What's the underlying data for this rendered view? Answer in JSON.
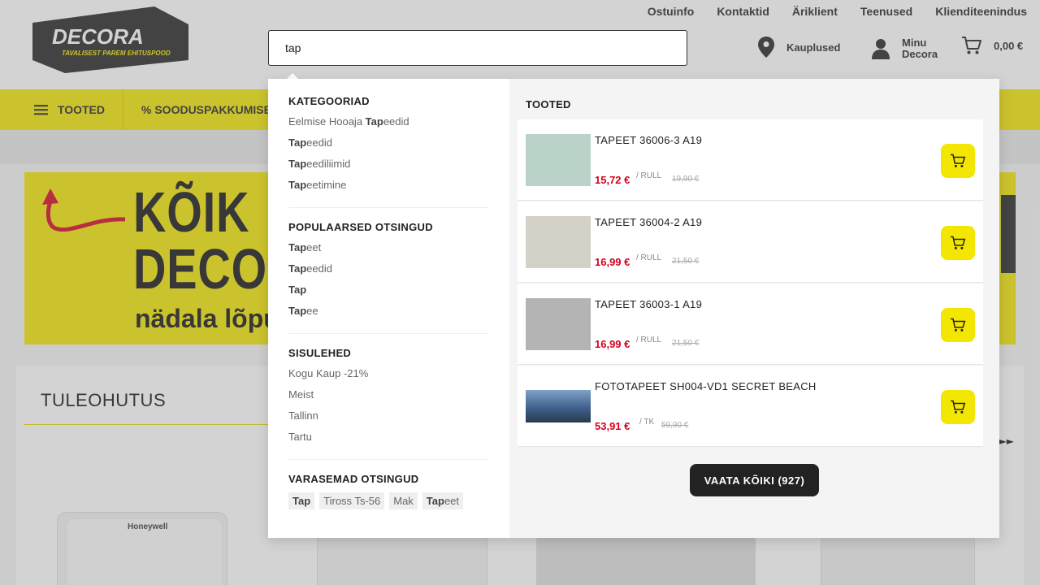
{
  "header": {
    "logo_text": "DECORA",
    "logo_tagline": "TAVALISEST PAREM EHITUSPOOD",
    "top_links": [
      "Ostuinfo",
      "Kontaktid",
      "Äriklient",
      "Teenused",
      "Klienditeenindus"
    ],
    "search_value": "tap",
    "stores_label": "Kauplused",
    "account_label_line1": "Minu",
    "account_label_line2": "Decora",
    "cart_total": "0,00 €"
  },
  "nav": {
    "products_label": "TOOTED",
    "offers_label": "% SOODUSPAKKUMISED"
  },
  "banner": {
    "line1": "KÕIK",
    "line2": "DECOR",
    "line3": "nädala lõpu"
  },
  "section": {
    "title": "TULEOHUTUS",
    "arrow": "►►"
  },
  "dropdown": {
    "categories": {
      "title": "KATEGOORIAD",
      "items": [
        {
          "pre": "Eelmise Hooaja ",
          "bold": "Tap",
          "post": "eedid"
        },
        {
          "pre": "",
          "bold": "Tap",
          "post": "eedid"
        },
        {
          "pre": "",
          "bold": "Tap",
          "post": "eediliimid"
        },
        {
          "pre": "",
          "bold": "Tap",
          "post": "eetimine"
        }
      ]
    },
    "popular": {
      "title": "POPULAARSED OTSINGUD",
      "items": [
        {
          "pre": "",
          "bold": "Tap",
          "post": "eet"
        },
        {
          "pre": "",
          "bold": "Tap",
          "post": "eedid"
        },
        {
          "pre": "",
          "bold": "Tap",
          "post": ""
        },
        {
          "pre": "",
          "bold": "Tap",
          "post": "ee"
        }
      ]
    },
    "content_pages": {
      "title": "SISULEHED",
      "items": [
        "Kogu Kaup -21%",
        "Meist",
        "Tallinn",
        "Tartu"
      ]
    },
    "previous": {
      "title": "VARASEMAD OTSINGUD",
      "chips": [
        {
          "bold": "Tap",
          "post": ""
        },
        {
          "bold": "",
          "post": "Tiross Ts-56"
        },
        {
          "bold": "",
          "post": "Mak"
        },
        {
          "bold": "Tap",
          "post": "eet"
        }
      ]
    },
    "products": {
      "title": "TOOTED",
      "items": [
        {
          "name": "TAPEET 36006-3 A19",
          "price": "15,72 €",
          "unit": "/ RULL",
          "old_price": "19,90 €",
          "color": "#b9d3c9"
        },
        {
          "name": "TAPEET 36004-2 A19",
          "price": "16,99 €",
          "unit": "/ RULL",
          "old_price": "21,50 €",
          "color": "#d4d1c6"
        },
        {
          "name": "TAPEET 36003-1 A19",
          "price": "16,99 €",
          "unit": "/ RULL",
          "old_price": "21,50 €",
          "color": "#b4b4b4"
        },
        {
          "name": "FOTOTAPEET SH004-VD1 SECRET BEACH",
          "price": "53,91 €",
          "unit": "/ TK",
          "old_price": "59,90 €",
          "color": "#3b5c86"
        }
      ],
      "view_all": "VAATA KÕIKI (927)"
    }
  },
  "colors": {
    "accent_yellow": "#f3e600",
    "price_red": "#d6001c",
    "dark": "#222222"
  }
}
